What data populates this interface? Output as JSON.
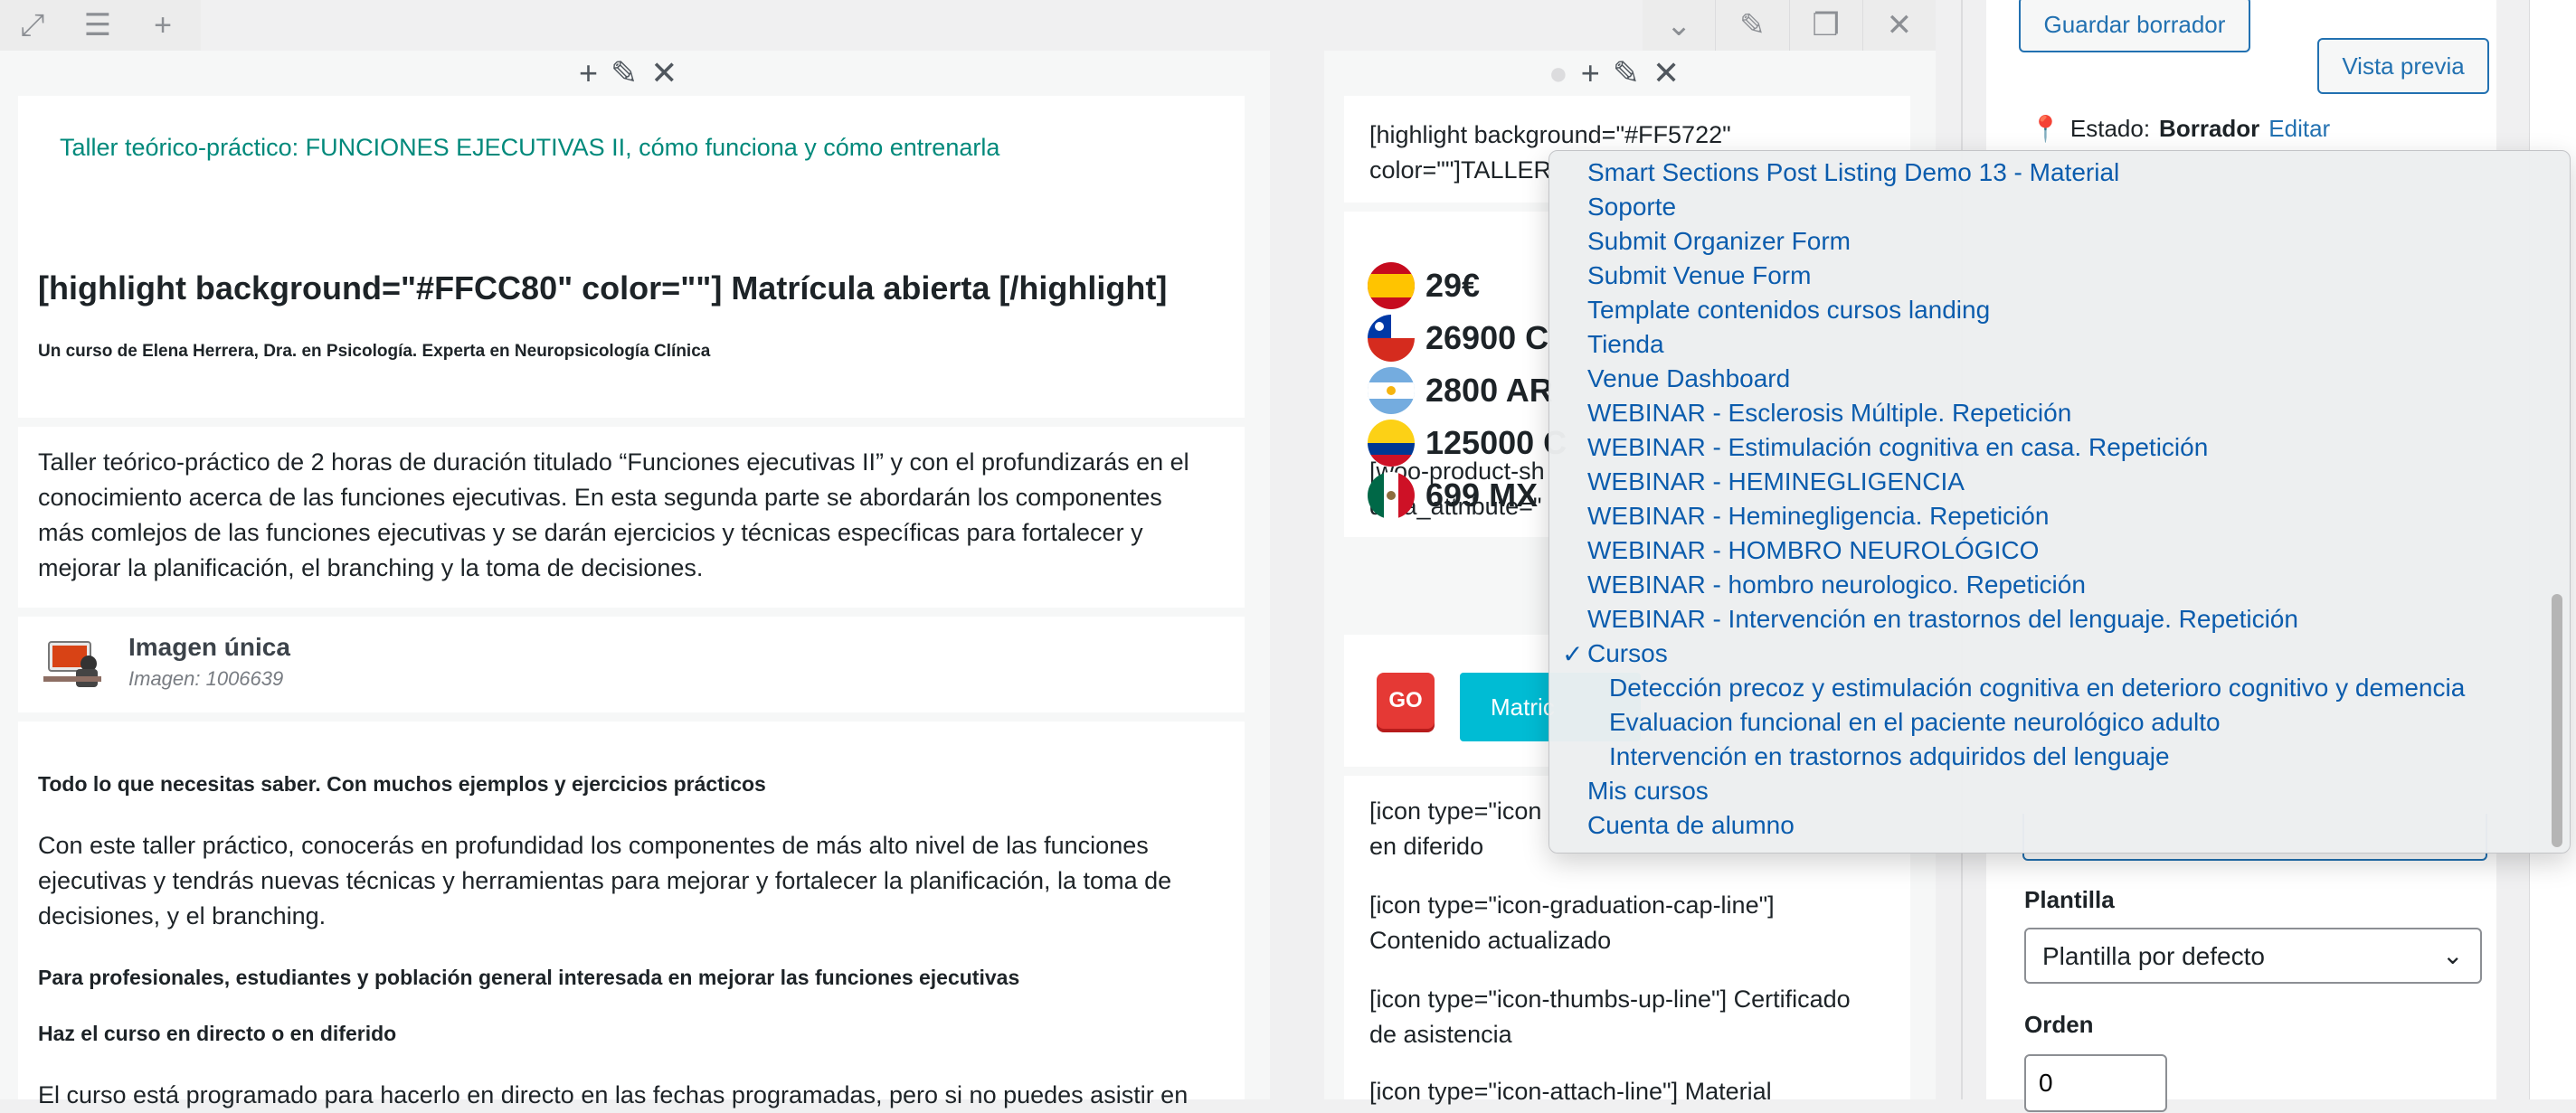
{
  "left_column": {
    "title": "Taller teórico-práctico: FUNCIONES EJECUTIVAS II, cómo funciona y cómo entrenarla",
    "highlight_heading": "[highlight background=\"#FFCC80\" color=\"\"] Matrícula abierta [/highlight]",
    "author_line": "Un curso de Elena Herrera, Dra. en Psicología. Experta en Neuropsicología Clínica",
    "description_lines": [
      "Taller teórico-práctico de 2 horas de duración titulado “Funciones ejecutivas II” y con el profundizarás en el",
      "conocimiento acerca de las funciones ejecutivas. En esta segunda parte se abordarán los componentes",
      "más comlejos de las funciones ejecutivas y se darán ejercicios y técnicas específicas para fortalecer y",
      "mejorar la planificación, el branching y la toma de decisiones."
    ],
    "image_module": {
      "title": "Imagen única",
      "subtitle": "Imagen: 1006639"
    },
    "section_heading_1": "Todo lo que necesitas saber. Con muchos ejemplos y ejercicios prácticos",
    "section_text_1": [
      "Con este taller práctico, conocerás en profundidad los componentes de más alto nivel de las funciones",
      "ejecutivas y tendrás nuevas técnicas y herramientas para mejorar y fortalecer la planificación, la toma de",
      "decisiones, y el branching."
    ],
    "section_heading_2": "Para profesionales, estudiantes y población general interesada en mejorar las funciones ejecutivas",
    "section_heading_3": "Haz el curso en directo o en diferido",
    "section_text_cut": "El curso está programado para hacerlo en directo en las fechas programadas, pero si no puedes asistir en"
  },
  "middle_column": {
    "code_1": [
      "[highlight background=\"#FF5722\"",
      "color=\"\"]TALLER"
    ],
    "prices": [
      "29€",
      "26900 C",
      "2800 AR",
      "125000 C",
      "699 MX"
    ],
    "code_2": [
      "[woo-product-sh",
      "data_attribute=\""
    ],
    "go_label": "GO",
    "enroll_label": "Matric",
    "icon_items": [
      [
        "[icon type=\"icon",
        "en diferido"
      ],
      [
        "[icon type=\"icon-graduation-cap-line\"]",
        "Contenido actualizado"
      ],
      [
        "[icon type=\"icon-thumbs-up-line\"] Certificado",
        "de asistencia"
      ],
      [
        "[icon type=\"icon-attach-line\"] Material",
        ""
      ]
    ]
  },
  "sidebar": {
    "save_draft": "Guardar borrador",
    "preview": "Vista previa",
    "status_label": "Estado:",
    "status_value": "Borrador",
    "status_edit": "Editar",
    "template_label": "Plantilla",
    "template_value": "Plantilla por defecto",
    "order_label": "Orden",
    "order_value": "0"
  },
  "dropdown": {
    "items": [
      "Smart Sections Post Listing Demo 13 - Material",
      "Soporte",
      "Submit Organizer Form",
      "Submit Venue Form",
      "Template contenidos cursos landing",
      "Tienda",
      "Venue Dashboard",
      "WEBINAR - Esclerosis Múltiple. Repetición",
      "WEBINAR - Estimulación cognitiva en casa. Repetición",
      "WEBINAR - HEMINEGLIGENCIA",
      "WEBINAR - Heminegligencia. Repetición",
      "WEBINAR - HOMBRO NEUROLÓGICO",
      "WEBINAR - hombro neurologico. Repetición",
      "WEBINAR - Intervención en trastornos del lenguaje. Repetición",
      "Cursos",
      "Detección precoz y estimulación cognitiva en deterioro cognitivo y demencia",
      "Evaluacion funcional en el paciente neurológico adulto",
      "Intervención en trastornos adquiridos del lenguaje",
      "Mis cursos",
      "Cuenta de alumno"
    ],
    "checkmark": "✓"
  },
  "colors": {
    "accent": "#2271b1",
    "teal": "#00897b",
    "cyan_button": "#00bcd4",
    "go_red": "#e53935"
  }
}
